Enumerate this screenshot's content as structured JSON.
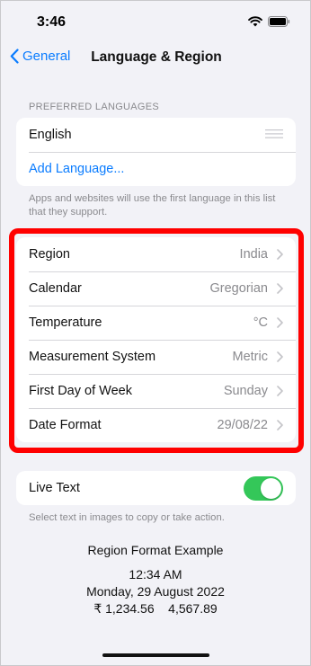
{
  "status_bar": {
    "time": "3:46"
  },
  "nav": {
    "back_label": "General",
    "title": "Language & Region"
  },
  "preferred_languages": {
    "header": "PREFERRED LANGUAGES",
    "items": [
      {
        "label": "English"
      }
    ],
    "add_label": "Add Language...",
    "footnote": "Apps and websites will use the first language in this list that they support."
  },
  "region_settings": [
    {
      "label": "Region",
      "value": "India"
    },
    {
      "label": "Calendar",
      "value": "Gregorian"
    },
    {
      "label": "Temperature",
      "value": "°C"
    },
    {
      "label": "Measurement System",
      "value": "Metric"
    },
    {
      "label": "First Day of Week",
      "value": "Sunday"
    },
    {
      "label": "Date Format",
      "value": "29/08/22"
    }
  ],
  "live_text": {
    "label": "Live Text",
    "enabled": true,
    "footnote": "Select text in images to copy or take action."
  },
  "format_example": {
    "title": "Region Format Example",
    "time": "12:34 AM",
    "date": "Monday, 29 August 2022",
    "numbers": "₹ 1,234.56    4,567.89"
  },
  "colors": {
    "accent": "#0a7cff",
    "toggle_on": "#34c759",
    "highlight": "#ff0000"
  }
}
